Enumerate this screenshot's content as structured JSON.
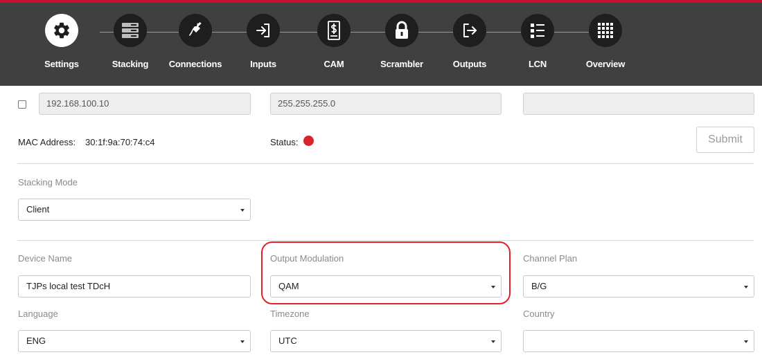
{
  "nav": {
    "steps": [
      {
        "label": "Settings",
        "icon": "gear-icon",
        "active": true
      },
      {
        "label": "Stacking",
        "icon": "server-stack-icon",
        "active": false
      },
      {
        "label": "Connections",
        "icon": "cable-plug-icon",
        "active": false
      },
      {
        "label": "Inputs",
        "icon": "sign-in-icon",
        "active": false
      },
      {
        "label": "CAM",
        "icon": "cam-card-icon",
        "active": false
      },
      {
        "label": "Scrambler",
        "icon": "lock-icon",
        "active": false
      },
      {
        "label": "Outputs",
        "icon": "sign-out-icon",
        "active": false
      },
      {
        "label": "LCN",
        "icon": "list-icon",
        "active": false
      },
      {
        "label": "Overview",
        "icon": "grid-icon",
        "active": false
      }
    ],
    "accent_color": "#c8102e"
  },
  "network": {
    "ip_address": "192.168.100.10",
    "subnet_mask": "255.255.255.0",
    "gateway": "",
    "checkbox_checked": false
  },
  "device_info": {
    "mac_label": "MAC Address:",
    "mac_value": "30:1f:9a:70:74:c4",
    "status_label": "Status:",
    "status_color": "#d9232e",
    "submit_label": "Submit"
  },
  "stacking": {
    "label": "Stacking Mode",
    "value": "Client"
  },
  "form": {
    "device_name_label": "Device Name",
    "device_name_value": "TJPs local test TDcH",
    "output_modulation_label": "Output Modulation",
    "output_modulation_value": "QAM",
    "channel_plan_label": "Channel Plan",
    "channel_plan_value": "B/G",
    "language_label": "Language",
    "language_value": "ENG",
    "timezone_label": "Timezone",
    "timezone_value": "UTC",
    "country_label": "Country",
    "country_value": ""
  }
}
